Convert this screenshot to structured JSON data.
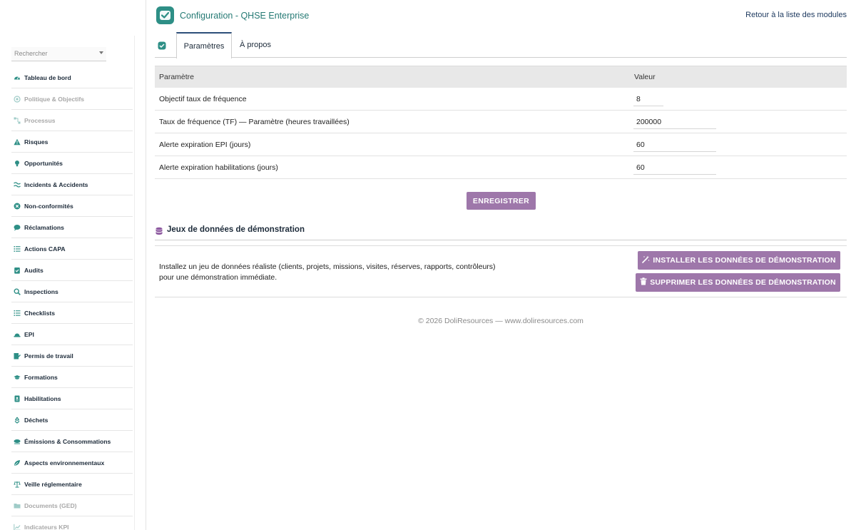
{
  "header": {
    "title": "Configuration - QHSE Enterprise",
    "back_link": "Retour à la liste des modules"
  },
  "sidebar": {
    "search_placeholder": "Rechercher",
    "items": [
      {
        "label": "Tableau de bord",
        "icon": "dashboard-icon",
        "enabled": true
      },
      {
        "label": "Politique & Objectifs",
        "icon": "target-icon",
        "enabled": false
      },
      {
        "label": "Processus",
        "icon": "process-icon",
        "enabled": false
      },
      {
        "label": "Risques",
        "icon": "warning-icon",
        "enabled": true
      },
      {
        "label": "Opportunités",
        "icon": "lightbulb-icon",
        "enabled": true
      },
      {
        "label": "Incidents & Accidents",
        "icon": "incident-icon",
        "enabled": true
      },
      {
        "label": "Non-conformités",
        "icon": "x-circle-icon",
        "enabled": true
      },
      {
        "label": "Réclamations",
        "icon": "comment-icon",
        "enabled": true
      },
      {
        "label": "Actions CAPA",
        "icon": "list-icon",
        "enabled": true
      },
      {
        "label": "Audits",
        "icon": "clipboard-check-icon",
        "enabled": true
      },
      {
        "label": "Inspections",
        "icon": "magnifier-icon",
        "enabled": true
      },
      {
        "label": "Checklists",
        "icon": "checklist-icon",
        "enabled": true
      },
      {
        "label": "EPI",
        "icon": "hard-hat-icon",
        "enabled": true
      },
      {
        "label": "Permis de travail",
        "icon": "permit-icon",
        "enabled": true
      },
      {
        "label": "Formations",
        "icon": "graduation-cap-icon",
        "enabled": true
      },
      {
        "label": "Habilitations",
        "icon": "id-badge-icon",
        "enabled": true
      },
      {
        "label": "Déchets",
        "icon": "recycle-icon",
        "enabled": true
      },
      {
        "label": "Émissions & Consommations",
        "icon": "cloud-icon",
        "enabled": true
      },
      {
        "label": "Aspects environnementaux",
        "icon": "leaf-icon",
        "enabled": true
      },
      {
        "label": "Veille réglementaire",
        "icon": "scale-icon",
        "enabled": true
      },
      {
        "label": "Documents (GED)",
        "icon": "folder-icon",
        "enabled": false
      },
      {
        "label": "Indicateurs KPI",
        "icon": "chart-icon",
        "enabled": false
      }
    ]
  },
  "tabs": {
    "active": "Paramètres",
    "other": "À propos"
  },
  "params": {
    "col_param": "Paramètre",
    "col_value": "Valeur",
    "rows": [
      {
        "label": "Objectif taux de fréquence",
        "value": "8"
      },
      {
        "label": "Taux de fréquence (TF) — Paramètre (heures travaillées)",
        "value": "200000"
      },
      {
        "label": "Alerte expiration EPI (jours)",
        "value": "60"
      },
      {
        "label": "Alerte expiration habilitations (jours)",
        "value": "60"
      }
    ]
  },
  "save_button": "ENREGISTRER",
  "demo": {
    "title": "Jeux de données de démonstration",
    "desc_line1": "Installez un jeu de données réaliste (clients, projets, missions, visites, réserves, rapports, contrôleurs)",
    "desc_line2": "pour une démonstration immédiate.",
    "install_button": "INSTALLER LES DONNÉES DE DÉMONSTRATION",
    "delete_button": "SUPPRIMER LES DONNÉES DE DÉMONSTRATION"
  },
  "footer": "© 2026 DoliResources — www.doliresources.com",
  "colors": {
    "accent": "#2e8f86",
    "button": "#9e77aa",
    "header_row": "#e8e8e8"
  }
}
